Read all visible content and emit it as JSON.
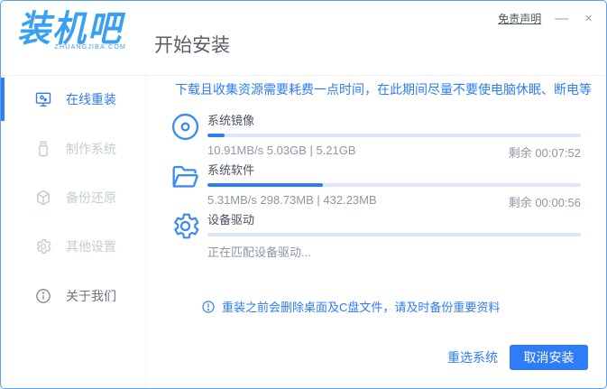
{
  "window": {
    "logo": {
      "brand": "装机吧",
      "domain": "ZHUANGJIBA.COM"
    },
    "title": "开始安装",
    "disclaimer": "免责声明",
    "minimize": "—",
    "close": "×"
  },
  "sidebar": {
    "items": [
      {
        "label": "在线重装",
        "icon": "monitor-reinstall-icon",
        "active": true
      },
      {
        "label": "制作系统",
        "icon": "usb-drive-icon",
        "active": false
      },
      {
        "label": "备份还原",
        "icon": "backup-cube-icon",
        "active": false
      },
      {
        "label": "其他设置",
        "icon": "gear-icon",
        "active": false
      },
      {
        "label": "关于我们",
        "icon": "info-icon",
        "active": false
      }
    ]
  },
  "main": {
    "notice": "下载且收集资源需要耗费一点时间，在此期间尽量不要使电脑休眠、断电等",
    "tasks": [
      {
        "name": "系统镜像",
        "icon": "disc-icon",
        "progress_percent": 4.5,
        "stats": "10.91MB/s 5.03GB | 5.21GB",
        "remaining": "剩余 00:07:52"
      },
      {
        "name": "系统软件",
        "icon": "folder-icon",
        "progress_percent": 31,
        "stats": "5.31MB/s 298.73MB | 432.23MB",
        "remaining": "剩余 00:00:56"
      },
      {
        "name": "设备驱动",
        "icon": "gear-icon",
        "progress_percent": 0,
        "stats": "正在匹配设备驱动...",
        "remaining": ""
      }
    ],
    "warning": "重装之前会删除桌面及C盘文件，请及时备份重要资料"
  },
  "footer": {
    "reselect_label": "重选系统",
    "cancel_label": "取消安装"
  },
  "colors": {
    "accent_blue": "#2e7cf6",
    "logo_blue": "#3aa0f2",
    "progress_track": "#dde7f8",
    "inactive_gray": "#c3ccd6",
    "window_border": "#5ba2ee"
  }
}
